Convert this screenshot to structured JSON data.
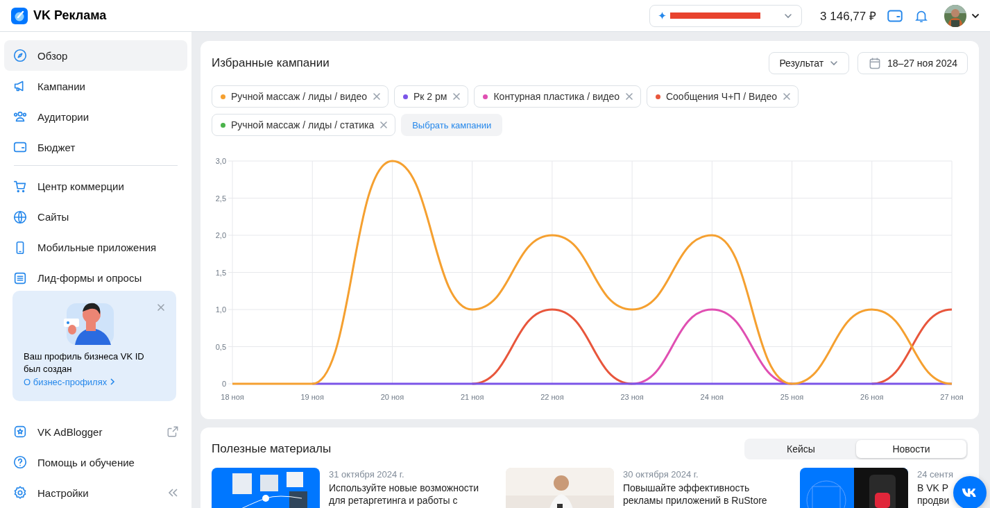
{
  "header": {
    "logo": "VK Реклама",
    "balance": "3 146,77 ₽"
  },
  "sidebar": {
    "groups": [
      {
        "items": [
          {
            "label": "Обзор",
            "selected": true
          },
          {
            "label": "Кампании",
            "selected": false
          },
          {
            "label": "Аудитории",
            "selected": false
          },
          {
            "label": "Бюджет",
            "selected": false
          }
        ]
      },
      {
        "items": [
          {
            "label": "Центр коммерции",
            "selected": false
          },
          {
            "label": "Сайты",
            "selected": false
          },
          {
            "label": "Мобильные приложения",
            "selected": false
          },
          {
            "label": "Лид-формы и опросы",
            "selected": false
          }
        ]
      }
    ],
    "promo": {
      "text": "Ваш профиль бизнеса VK ID был создан",
      "link": "О бизнес-профилях"
    },
    "bottom_items": [
      {
        "label": "VK AdBlogger"
      },
      {
        "label": "Помощь и обучение"
      },
      {
        "label": "Настройки"
      }
    ]
  },
  "favorites": {
    "title": "Избранные кампании",
    "metric": "Результат",
    "period": "18–27 ноя 2024",
    "campaigns": [
      {
        "label": "Ручной массаж / лиды / видео",
        "color": "#f5a030"
      },
      {
        "label": "Рк 2 рм",
        "color": "#7b55e8"
      },
      {
        "label": "Контурная пластика / видео",
        "color": "#e04fb2"
      },
      {
        "label": "Сообщения Ч+П / Видео",
        "color": "#e8563c"
      },
      {
        "label": "Ручной массаж / лиды / статика",
        "color": "#4bb34b"
      }
    ],
    "select_button": "Выбрать кампании",
    "chart_data": {
      "type": "line",
      "categories": [
        "18 ноя",
        "19 ноя",
        "20 ноя",
        "21 ноя",
        "22 ноя",
        "23 ноя",
        "24 ноя",
        "25 ноя",
        "26 ноя",
        "27 ноя"
      ],
      "ylim": [
        0,
        3
      ],
      "yticks": [
        0,
        {
          "value": 0.5,
          "label": "0,5"
        },
        {
          "value": 1,
          "label": "1,0"
        },
        {
          "value": 1.5,
          "label": "1,5"
        },
        {
          "value": 2,
          "label": "2,0"
        },
        {
          "value": 2.5,
          "label": "2,5"
        },
        {
          "value": 3,
          "label": "3,0"
        }
      ],
      "grid": true,
      "series": [
        {
          "color": "#e8563c",
          "values": [
            null,
            null,
            null,
            0,
            1,
            0,
            null,
            null,
            0,
            1
          ]
        },
        {
          "color": "#e04fb2",
          "values": [
            null,
            null,
            null,
            null,
            null,
            0,
            1,
            0,
            null,
            null
          ]
        },
        {
          "color": "#7b55e8",
          "values": [
            null,
            0,
            0,
            0,
            0,
            0,
            0,
            0,
            0,
            0
          ]
        },
        {
          "color": "#f5a030",
          "values": [
            0,
            0,
            3,
            1,
            2,
            1,
            2,
            0,
            1,
            0
          ]
        }
      ]
    }
  },
  "materials": {
    "title": "Полезные материалы",
    "tabs": [
      {
        "label": "Кейсы",
        "selected": false
      },
      {
        "label": "Новости",
        "selected": true
      }
    ],
    "articles": [
      {
        "date": "31 октября 2024 г.",
        "title": "Используйте новые возможности для ретаргетинга и работы с"
      },
      {
        "date": "30 октября 2024 г.",
        "title": "Повышайте эффективность рекламы приложений в RuStore"
      },
      {
        "date": "24 сентя",
        "title": "В VK Р продви"
      }
    ]
  }
}
